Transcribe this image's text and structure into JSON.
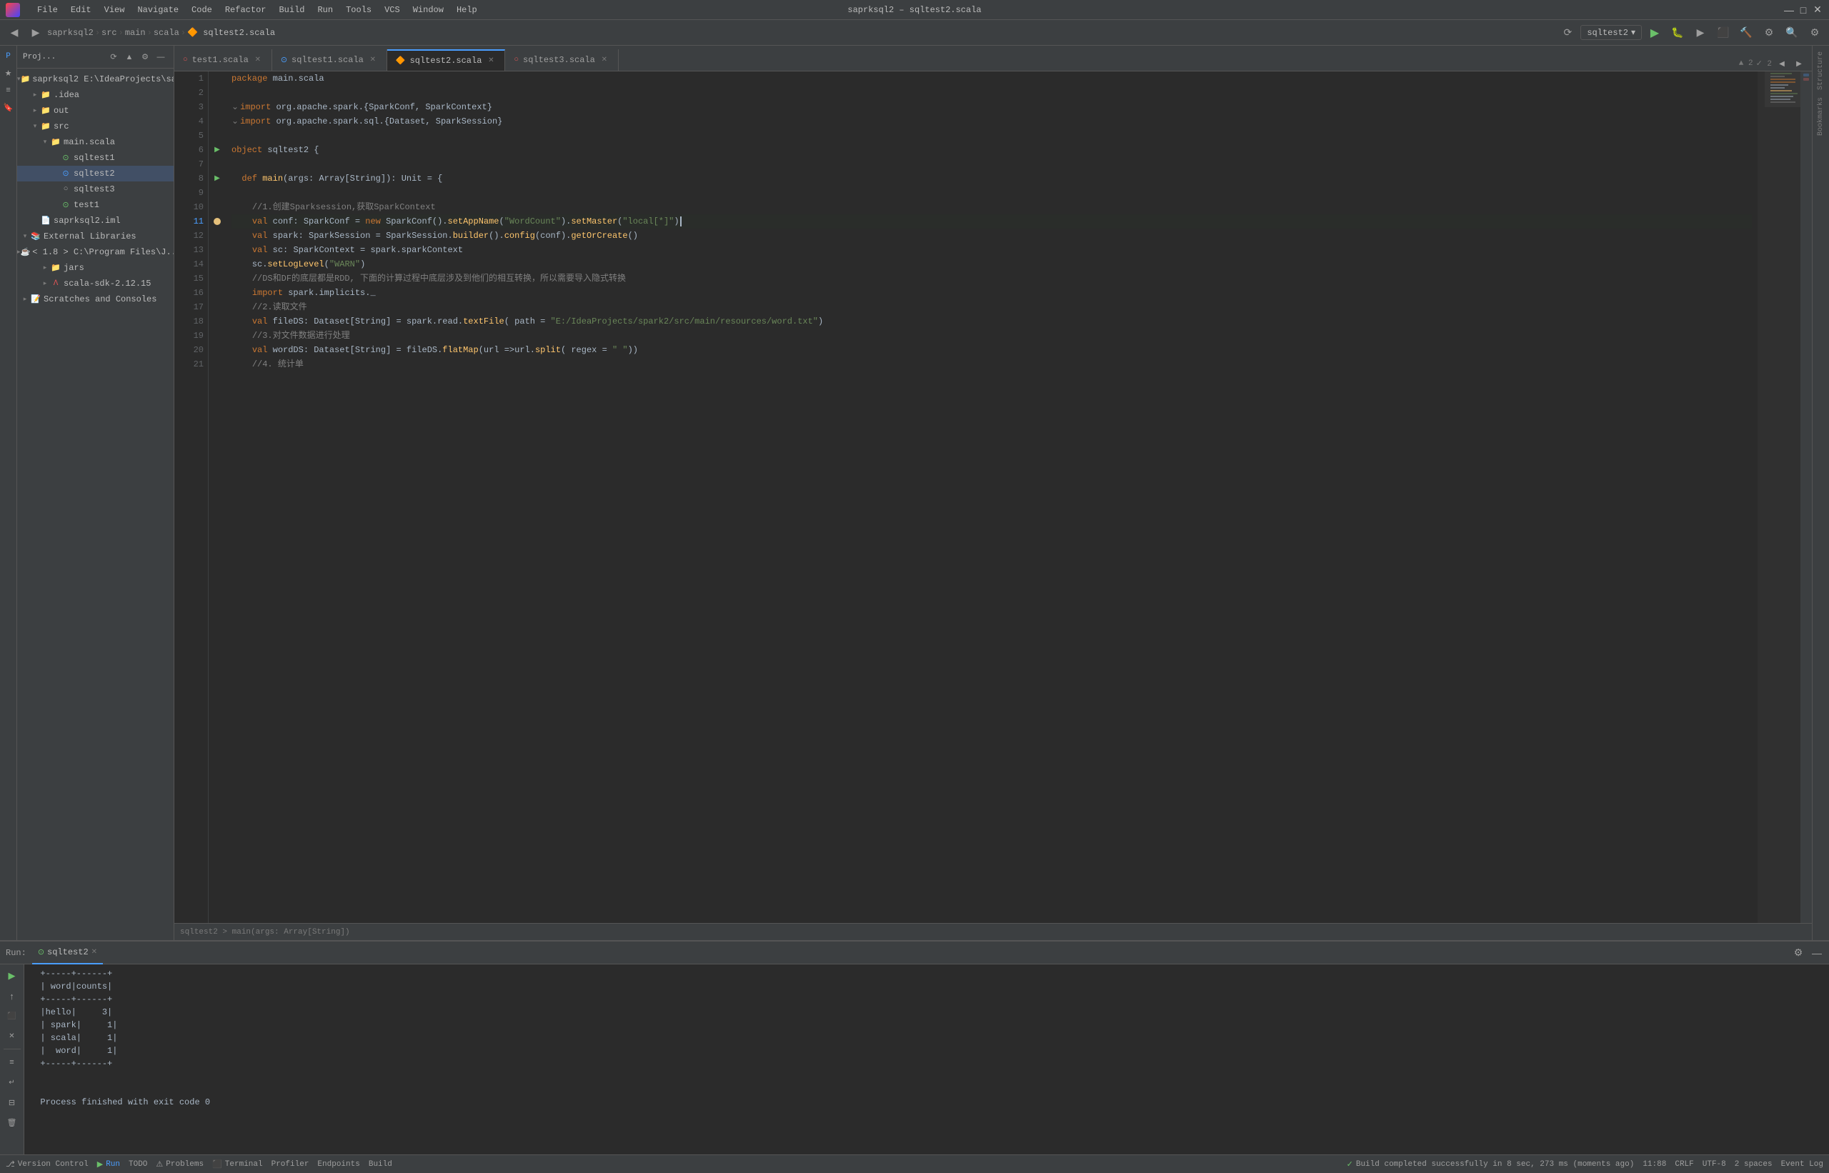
{
  "titlebar": {
    "menu": [
      "File",
      "Edit",
      "View",
      "Navigate",
      "Code",
      "Refactor",
      "Build",
      "Run",
      "Tools",
      "VCS",
      "Window",
      "Help"
    ],
    "title": "saprksql2 – sqltest2.scala",
    "controls": [
      "—",
      "□",
      "✕"
    ]
  },
  "toolbar": {
    "breadcrumb": [
      "saprksql2",
      "src",
      "main",
      "scala",
      "sqltest2.scala"
    ],
    "run_config": "sqltest2",
    "line_col": "11:88",
    "encoding": "UTF-8",
    "line_ending": "CRLF",
    "spaces": "2 spaces"
  },
  "project_panel": {
    "title": "Proj...",
    "root": "saprksql2 E:\\IdeaProjects\\sap",
    "items": [
      {
        "label": ".idea",
        "type": "folder",
        "indent": 1,
        "expanded": false
      },
      {
        "label": "out",
        "type": "folder",
        "indent": 1,
        "expanded": false
      },
      {
        "label": "src",
        "type": "folder",
        "indent": 1,
        "expanded": true
      },
      {
        "label": "main.scala",
        "type": "folder",
        "indent": 2,
        "expanded": true
      },
      {
        "label": "sqltest1",
        "type": "scala_obj",
        "indent": 3,
        "expanded": false
      },
      {
        "label": "sqltest2",
        "type": "scala_active",
        "indent": 3,
        "expanded": false
      },
      {
        "label": "sqltest3",
        "type": "scala",
        "indent": 3,
        "expanded": false
      },
      {
        "label": "test1",
        "type": "scala_obj",
        "indent": 3,
        "expanded": false
      },
      {
        "label": "saprksql2.iml",
        "type": "iml",
        "indent": 1,
        "expanded": false
      },
      {
        "label": "External Libraries",
        "type": "ext_lib",
        "indent": 0,
        "expanded": true
      },
      {
        "label": "< 1.8 > C:\\Program Files\\J...",
        "type": "sdk",
        "indent": 1,
        "expanded": false
      },
      {
        "label": "jars",
        "type": "folder",
        "indent": 2,
        "expanded": false
      },
      {
        "label": "scala-sdk-2.12.15",
        "type": "sdk2",
        "indent": 2,
        "expanded": false
      },
      {
        "label": "Scratches and Consoles",
        "type": "scratches",
        "indent": 0,
        "expanded": false
      }
    ]
  },
  "tabs": [
    {
      "label": "test1.scala",
      "type": "scala",
      "active": false,
      "closable": true
    },
    {
      "label": "sqltest1.scala",
      "type": "scala_obj",
      "active": false,
      "closable": true
    },
    {
      "label": "sqltest2.scala",
      "type": "scala_active",
      "active": true,
      "closable": true
    },
    {
      "label": "sqltest3.scala",
      "type": "scala",
      "active": false,
      "closable": true
    }
  ],
  "code": {
    "lines": [
      {
        "num": 1,
        "content": "package main.scala",
        "tokens": [
          {
            "t": "kw",
            "v": "package"
          },
          {
            "t": "plain",
            "v": " main.scala"
          }
        ]
      },
      {
        "num": 2,
        "content": ""
      },
      {
        "num": 3,
        "content": "import org.apache.spark.{SparkConf, SparkContext}",
        "tokens": [
          {
            "t": "kw",
            "v": "import"
          },
          {
            "t": "plain",
            "v": " org.apache.spark.{"
          },
          {
            "t": "type",
            "v": "SparkConf"
          },
          {
            "t": "plain",
            "v": ", "
          },
          {
            "t": "type",
            "v": "SparkContext"
          },
          {
            "t": "plain",
            "v": "}"
          }
        ]
      },
      {
        "num": 4,
        "content": "import org.apache.spark.sql.{Dataset, SparkSession}",
        "tokens": [
          {
            "t": "kw",
            "v": "import"
          },
          {
            "t": "plain",
            "v": " org.apache.spark.sql.{"
          },
          {
            "t": "type",
            "v": "Dataset"
          },
          {
            "t": "plain",
            "v": ", "
          },
          {
            "t": "type",
            "v": "SparkSession"
          },
          {
            "t": "plain",
            "v": "}"
          }
        ]
      },
      {
        "num": 5,
        "content": ""
      },
      {
        "num": 6,
        "content": "object sqltest2 {",
        "tokens": [
          {
            "t": "kw",
            "v": "object"
          },
          {
            "t": "plain",
            "v": " sqltest2 {"
          }
        ]
      },
      {
        "num": 7,
        "content": ""
      },
      {
        "num": 8,
        "content": "  def main(args: Array[String]): Unit = {",
        "tokens": [
          {
            "t": "plain",
            "v": "  "
          },
          {
            "t": "kw",
            "v": "def"
          },
          {
            "t": "plain",
            "v": " "
          },
          {
            "t": "fn",
            "v": "main"
          },
          {
            "t": "plain",
            "v": "(args: "
          },
          {
            "t": "type",
            "v": "Array"
          },
          {
            "t": "plain",
            "v": "["
          },
          {
            "t": "type",
            "v": "String"
          },
          {
            "t": "plain",
            "v": "]): "
          },
          {
            "t": "type",
            "v": "Unit"
          },
          {
            "t": "plain",
            "v": " = {"
          }
        ]
      },
      {
        "num": 9,
        "content": ""
      },
      {
        "num": 10,
        "content": "    //1.创建Sparksession,获取SparkContext",
        "comment": true
      },
      {
        "num": 11,
        "content": "    val conf: SparkConf = new SparkConf().setAppName(\"WordCount\").setMaster(\"local[*]\")",
        "tokens": [
          {
            "t": "plain",
            "v": "    "
          },
          {
            "t": "kw",
            "v": "val"
          },
          {
            "t": "plain",
            "v": " conf: "
          },
          {
            "t": "type",
            "v": "SparkConf"
          },
          {
            "t": "plain",
            "v": " = "
          },
          {
            "t": "kw",
            "v": "new"
          },
          {
            "t": "plain",
            "v": " "
          },
          {
            "t": "type",
            "v": "SparkConf"
          },
          {
            "t": "plain",
            "v": "()."
          },
          {
            "t": "fn",
            "v": "setAppName"
          },
          {
            "t": "plain",
            "v": "("
          },
          {
            "t": "str",
            "v": "\"WordCount\""
          },
          {
            "t": "plain",
            "v": ")."
          },
          {
            "t": "fn",
            "v": "setMaster"
          },
          {
            "t": "plain",
            "v": "("
          },
          {
            "t": "str",
            "v": "\"local[*]\""
          },
          {
            "t": "plain",
            "v": ")"
          }
        ],
        "breakpoint": true
      },
      {
        "num": 12,
        "content": "    val spark: SparkSession = SparkSession.builder().config(conf).getOrCreate()",
        "tokens": [
          {
            "t": "plain",
            "v": "    "
          },
          {
            "t": "kw",
            "v": "val"
          },
          {
            "t": "plain",
            "v": " spark: "
          },
          {
            "t": "type",
            "v": "SparkSession"
          },
          {
            "t": "plain",
            "v": " = "
          },
          {
            "t": "type",
            "v": "SparkSession"
          },
          {
            "t": "plain",
            "v": "."
          },
          {
            "t": "fn",
            "v": "builder"
          },
          {
            "t": "plain",
            "v": "()."
          },
          {
            "t": "fn",
            "v": "config"
          },
          {
            "t": "plain",
            "v": "(conf)."
          },
          {
            "t": "fn",
            "v": "getOrCreate"
          },
          {
            "t": "plain",
            "v": "()"
          }
        ]
      },
      {
        "num": 13,
        "content": "    val sc: SparkContext = spark.sparkContext",
        "tokens": [
          {
            "t": "plain",
            "v": "    "
          },
          {
            "t": "kw",
            "v": "val"
          },
          {
            "t": "plain",
            "v": " sc: "
          },
          {
            "t": "type",
            "v": "SparkContext"
          },
          {
            "t": "plain",
            "v": " = spark.sparkContext"
          }
        ]
      },
      {
        "num": 14,
        "content": "    sc.setLogLevel(\"WARN\")",
        "tokens": [
          {
            "t": "plain",
            "v": "    sc."
          },
          {
            "t": "fn",
            "v": "setLogLevel"
          },
          {
            "t": "plain",
            "v": "("
          },
          {
            "t": "str",
            "v": "\"WARN\""
          },
          {
            "t": "plain",
            "v": ")"
          }
        ]
      },
      {
        "num": 15,
        "content": "    //DS和DF的底层都是RDD, 下面的计算过程中底层涉及到他们的相互转换，所以需要导入隐式转换",
        "comment": true
      },
      {
        "num": 16,
        "content": "    import spark.implicits._",
        "tokens": [
          {
            "t": "plain",
            "v": "    "
          },
          {
            "t": "kw",
            "v": "import"
          },
          {
            "t": "plain",
            "v": " spark.implicits._"
          }
        ]
      },
      {
        "num": 17,
        "content": "    //2.读取文件",
        "comment": true
      },
      {
        "num": 18,
        "content": "    val fileDS: Dataset[String] = spark.read.textFile( path = \"E:/IdeaProjects/spark2/src/main/resources/word.txt\")",
        "tokens": [
          {
            "t": "plain",
            "v": "    "
          },
          {
            "t": "kw",
            "v": "val"
          },
          {
            "t": "plain",
            "v": " fileDS: "
          },
          {
            "t": "type",
            "v": "Dataset"
          },
          {
            "t": "plain",
            "v": "["
          },
          {
            "t": "type",
            "v": "String"
          },
          {
            "t": "plain",
            "v": "] = spark.read."
          },
          {
            "t": "fn",
            "v": "textFile"
          },
          {
            "t": "plain",
            "v": "( path = "
          },
          {
            "t": "str",
            "v": "\"E:/IdeaProjects/spark2/src/main/resources/word.txt\""
          },
          {
            "t": "plain",
            "v": ")"
          }
        ]
      },
      {
        "num": 19,
        "content": "    //3.对文件数据进行处理",
        "comment": true
      },
      {
        "num": 20,
        "content": "    val wordDS: Dataset[String] = fileDS.flatMap(url =>url.split( regex = \" \"))",
        "tokens": [
          {
            "t": "plain",
            "v": "    "
          },
          {
            "t": "kw",
            "v": "val"
          },
          {
            "t": "plain",
            "v": " wordDS: "
          },
          {
            "t": "type",
            "v": "Dataset"
          },
          {
            "t": "plain",
            "v": "["
          },
          {
            "t": "type",
            "v": "String"
          },
          {
            "t": "plain",
            "v": "] = fileDS."
          },
          {
            "t": "fn",
            "v": "flatMap"
          },
          {
            "t": "plain",
            "v": "(url =>url."
          },
          {
            "t": "fn",
            "v": "split"
          },
          {
            "t": "plain",
            "v": "( regex = "
          },
          {
            "t": "str",
            "v": "\" \""
          },
          {
            "t": "plain",
            "v": "))"
          }
        ]
      },
      {
        "num": 21,
        "content": "    //4. 统计单",
        "comment": true
      }
    ],
    "breadcrumb": "sqltest2 > main(args: Array[String])"
  },
  "run_panel": {
    "label": "Run:",
    "tab": "sqltest2",
    "output": [
      "+-----+------+",
      "| word|counts|",
      "+-----+------+",
      "|hello|     3|",
      "| spark|     1|",
      "| scala|     1|",
      "| word|     1|",
      "+-----+------+",
      "",
      "",
      "Process finished with exit code 0"
    ]
  },
  "status_bar": {
    "items": [
      "Version Control",
      "Run",
      "TODO",
      "Problems",
      "Terminal",
      "Profiler",
      "Endpoints",
      "Build"
    ],
    "active": "Run",
    "message": "Build completed successfully in 8 sec, 273 ms (moments ago)",
    "position": "11:88",
    "line_ending": "CRLF",
    "encoding": "UTF-8",
    "indent": "2 spaces",
    "event_log": "Event Log"
  },
  "colors": {
    "accent": "#4a9eff",
    "bg_dark": "#2b2b2b",
    "bg_panel": "#3c3f41",
    "text_main": "#a9b7c6",
    "keyword": "#cc7832",
    "string": "#6a8759",
    "comment": "#808080",
    "function": "#ffc66d",
    "type": "#a9b7c6",
    "number": "#6897bb",
    "green": "#6abf69"
  }
}
